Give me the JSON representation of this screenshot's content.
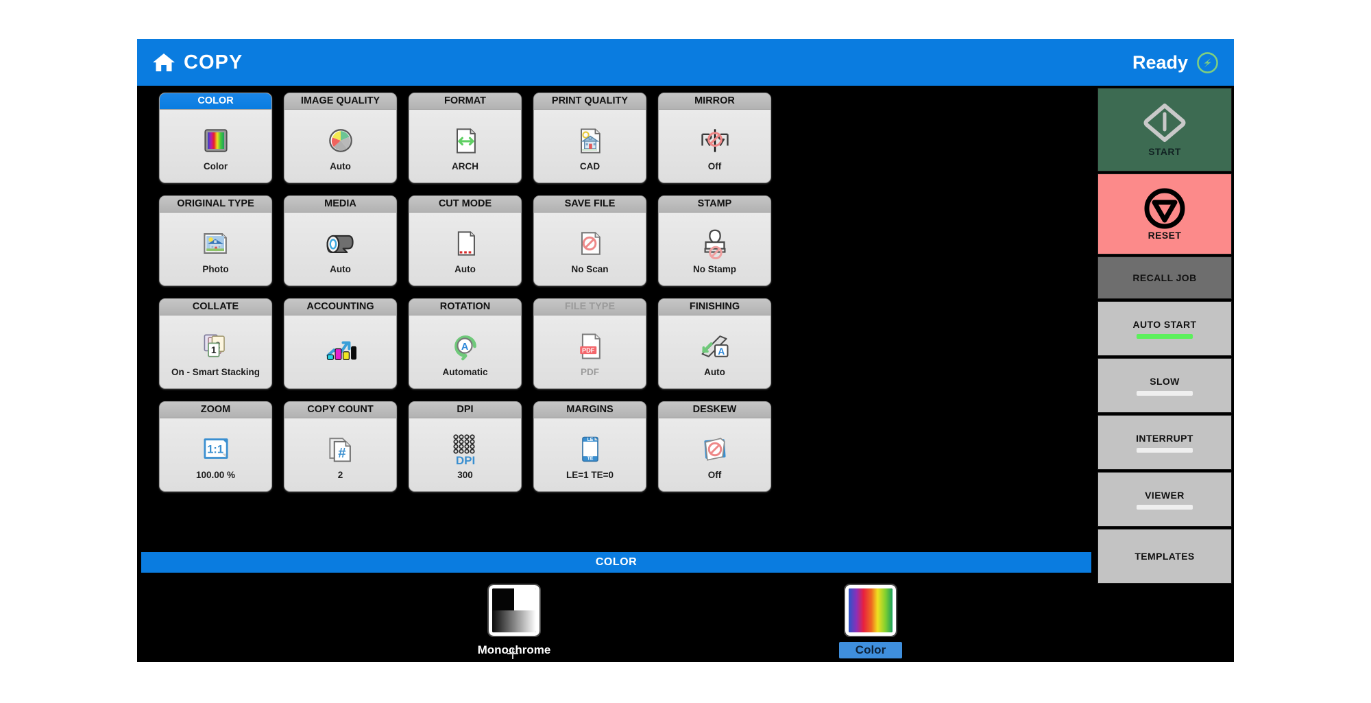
{
  "header": {
    "home_icon": "home-icon",
    "title": "COPY",
    "status": "Ready",
    "status_icon": "energy-saver-icon"
  },
  "accent_colors": {
    "brand_blue": "#0a7ce0",
    "selected_header": "#0a7ce0",
    "start_green": "#3d6b52",
    "reset_red": "#fc8a8a",
    "indicator_on": "#5cf05c",
    "panel_gray": "#c3c3c3",
    "tile_face": "#e3e3e3"
  },
  "grid": {
    "tiles": [
      {
        "title": "COLOR",
        "value": "Color",
        "icon": "color-swatch-icon",
        "selected": true,
        "disabled": false
      },
      {
        "title": "IMAGE QUALITY",
        "value": "Auto",
        "icon": "pie-chart-icon",
        "selected": false,
        "disabled": false
      },
      {
        "title": "FORMAT",
        "value": "ARCH",
        "icon": "page-arrows-icon",
        "selected": false,
        "disabled": false
      },
      {
        "title": "PRINT QUALITY",
        "value": "CAD",
        "icon": "house-page-icon",
        "selected": false,
        "disabled": false
      },
      {
        "title": "MIRROR",
        "value": "Off",
        "icon": "mirror-off-icon",
        "selected": false,
        "disabled": false
      },
      {
        "title": "ORIGINAL TYPE",
        "value": "Photo",
        "icon": "photo-icon",
        "selected": false,
        "disabled": false
      },
      {
        "title": "MEDIA",
        "value": "Auto",
        "icon": "paper-roll-icon",
        "selected": false,
        "disabled": false
      },
      {
        "title": "CUT MODE",
        "value": "Auto",
        "icon": "cut-page-icon",
        "selected": false,
        "disabled": false
      },
      {
        "title": "SAVE FILE",
        "value": "No Scan",
        "icon": "no-scan-icon",
        "selected": false,
        "disabled": false
      },
      {
        "title": "STAMP",
        "value": "No Stamp",
        "icon": "no-stamp-icon",
        "selected": false,
        "disabled": false
      },
      {
        "title": "COLLATE",
        "value": "On - Smart Stacking",
        "icon": "collate-icon",
        "selected": false,
        "disabled": false
      },
      {
        "title": "ACCOUNTING",
        "value": "",
        "icon": "accounting-icon",
        "selected": false,
        "disabled": false
      },
      {
        "title": "ROTATION",
        "value": "Automatic",
        "icon": "rotation-auto-icon",
        "selected": false,
        "disabled": false
      },
      {
        "title": "FILE TYPE",
        "value": "PDF",
        "icon": "pdf-file-icon",
        "selected": false,
        "disabled": true
      },
      {
        "title": "FINISHING",
        "value": "Auto",
        "icon": "finishing-icon",
        "selected": false,
        "disabled": false
      },
      {
        "title": "ZOOM",
        "value": "100.00 %",
        "icon": "zoom-one-to-one-icon",
        "selected": false,
        "disabled": false
      },
      {
        "title": "COPY COUNT",
        "value": "2",
        "icon": "copy-count-icon",
        "selected": false,
        "disabled": false
      },
      {
        "title": "DPI",
        "value": "300",
        "icon": "dpi-icon",
        "selected": false,
        "disabled": false
      },
      {
        "title": "MARGINS",
        "value": "LE=1   TE=0",
        "icon": "margins-icon",
        "selected": false,
        "disabled": false
      },
      {
        "title": "DESKEW",
        "value": "Off",
        "icon": "deskew-off-icon",
        "selected": false,
        "disabled": false
      }
    ]
  },
  "sidebar": {
    "start": {
      "label": "START",
      "icon": "power-diamond-icon"
    },
    "reset": {
      "label": "RESET",
      "icon": "stop-triangle-icon"
    },
    "recall": {
      "label": "RECALL JOB"
    },
    "buttons": [
      {
        "label": "AUTO START",
        "indicator": "on"
      },
      {
        "label": "SLOW",
        "indicator": "off"
      },
      {
        "label": "INTERRUPT",
        "indicator": "off"
      },
      {
        "label": "VIEWER",
        "indicator": "off"
      },
      {
        "label": "TEMPLATES",
        "indicator": "none"
      }
    ]
  },
  "options": {
    "title": "COLOR",
    "items": [
      {
        "label": "Monochrome",
        "icon": "monochrome-swatch-icon",
        "selected": false
      },
      {
        "label": "Color",
        "icon": "color-spectrum-icon",
        "selected": true
      }
    ]
  }
}
